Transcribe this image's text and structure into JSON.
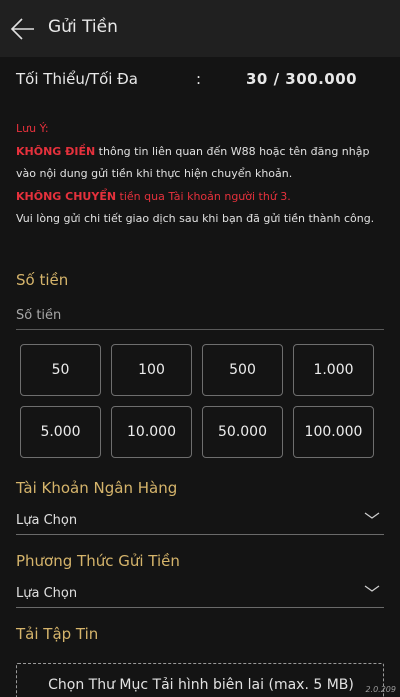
{
  "header": {
    "title": "Gửi Tiền",
    "back_icon": "arrow-left-icon"
  },
  "limits": {
    "label": "Tối Thiểu/Tối Đa",
    "separator": ":",
    "value": "30 / 300.000"
  },
  "notice": {
    "heading": "Lưu Ý:",
    "line1_strong": "KHÔNG ĐIỀN",
    "line1_rest": " thông tin liên quan đến W88 hoặc tên đăng nhập vào nội dung gửi tiền khi thực hiện chuyển khoản.",
    "line2_strong": "KHÔNG CHUYỂN",
    "line2_rest": " tiền qua Tài khoản người thứ 3.",
    "line3": "Vui lòng gửi chi tiết giao dịch sau khi bạn đã gửi tiền thành công."
  },
  "amount": {
    "label": "Số tiền",
    "placeholder": "Số tiền",
    "value": ""
  },
  "quick_amounts": [
    "50",
    "100",
    "500",
    "1.000",
    "5.000",
    "10.000",
    "50.000",
    "100.000"
  ],
  "bank_account": {
    "label": "Tài Khoản Ngân Hàng",
    "selected": "Lựa Chọn"
  },
  "deposit_method": {
    "label": "Phương Thức Gửi Tiền",
    "selected": "Lựa Chọn"
  },
  "upload": {
    "label": "Tải Tập Tin",
    "button": "Chọn Thư Mục Tải hình biên lai (max. 5 MB)"
  },
  "version": "2.0.209",
  "colors": {
    "background": "#141414",
    "header": "#202020",
    "gold": "#d5b46b",
    "red": "#e5313c"
  }
}
